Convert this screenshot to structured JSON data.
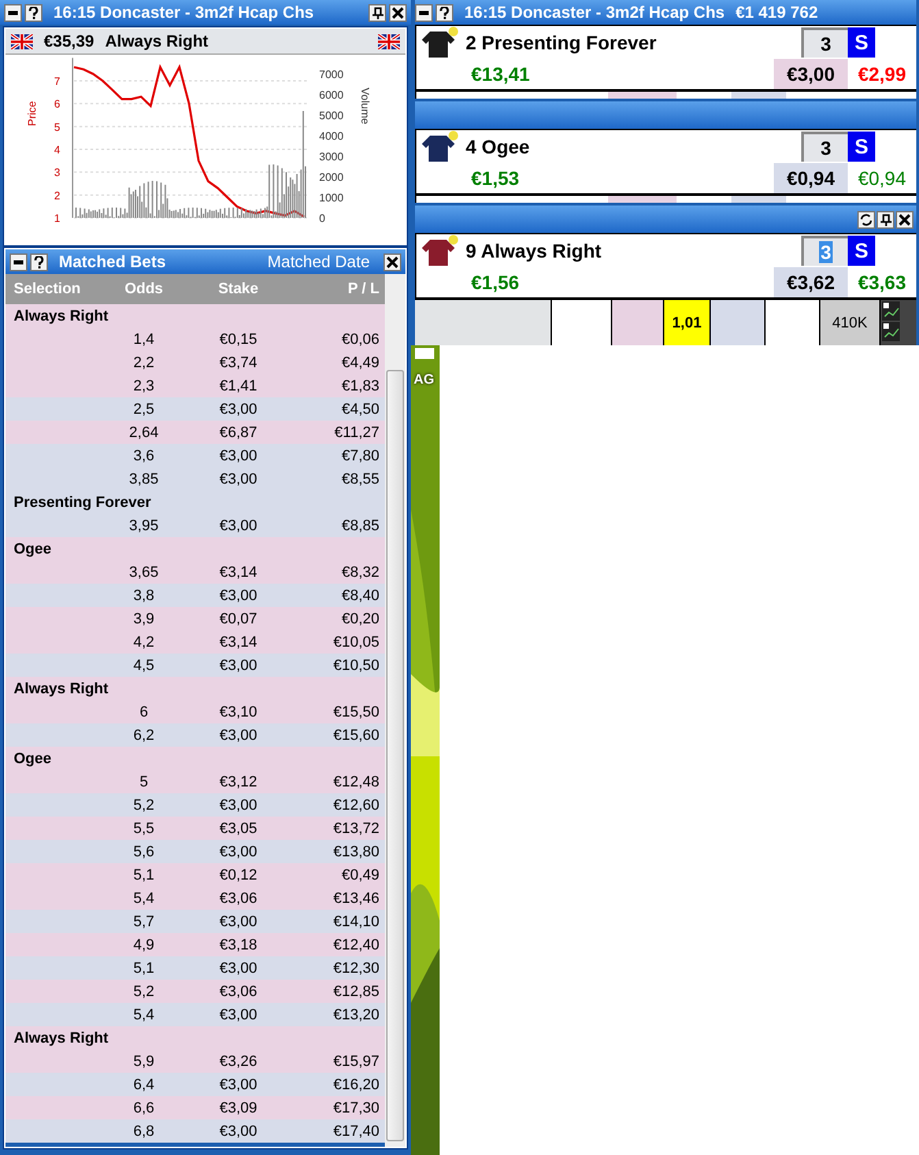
{
  "market_window": {
    "title": "16:15  Doncaster - 3m2f Hcap Chs",
    "runner": {
      "pl": "€35,39",
      "name": "Always Right"
    },
    "chart": {
      "chart_data": {
        "type": "line",
        "ylabel": "Price",
        "yticks": [
          1,
          2,
          3,
          4,
          5,
          6,
          7
        ],
        "ylim": [
          1,
          8
        ],
        "grid": true,
        "series": [
          {
            "color": "#e00000",
            "values": [
              7.6,
              7.5,
              7.3,
              7.0,
              6.6,
              6.2,
              6.2,
              6.3,
              5.9,
              7.6,
              6.8,
              7.6,
              6.0,
              3.5,
              2.6,
              2.3,
              1.9,
              1.5,
              1.3,
              1.2,
              1.3,
              1.2,
              1.1,
              1.3,
              1.05
            ]
          }
        ]
      },
      "volume_label": "Volume",
      "volume_ticks": [
        "7000",
        "6000",
        "5000",
        "4000",
        "3000",
        "2000",
        "1000",
        "0"
      ]
    }
  },
  "matched_bets": {
    "title": "Matched Bets",
    "sort_link": "Matched Date",
    "columns": [
      "Selection",
      "Odds",
      "Stake",
      "P / L"
    ],
    "groups": [
      {
        "selection": "Always Right",
        "kind": "back",
        "bets": [
          {
            "odds": "1,4",
            "stake": "€0,15",
            "pl": "€0,06",
            "kind": "back"
          },
          {
            "odds": "2,2",
            "stake": "€3,74",
            "pl": "€4,49",
            "kind": "back"
          },
          {
            "odds": "2,3",
            "stake": "€1,41",
            "pl": "€1,83",
            "kind": "back"
          },
          {
            "odds": "2,5",
            "stake": "€3,00",
            "pl": "€4,50",
            "kind": "lay"
          },
          {
            "odds": "2,64",
            "stake": "€6,87",
            "pl": "€11,27",
            "kind": "back"
          },
          {
            "odds": "3,6",
            "stake": "€3,00",
            "pl": "€7,80",
            "kind": "lay"
          },
          {
            "odds": "3,85",
            "stake": "€3,00",
            "pl": "€8,55",
            "kind": "lay"
          }
        ]
      },
      {
        "selection": "Presenting Forever",
        "kind": "lay",
        "bets": [
          {
            "odds": "3,95",
            "stake": "€3,00",
            "pl": "€8,85",
            "kind": "lay"
          }
        ]
      },
      {
        "selection": "Ogee",
        "kind": "back",
        "bets": [
          {
            "odds": "3,65",
            "stake": "€3,14",
            "pl": "€8,32",
            "kind": "back"
          },
          {
            "odds": "3,8",
            "stake": "€3,00",
            "pl": "€8,40",
            "kind": "lay"
          },
          {
            "odds": "3,9",
            "stake": "€0,07",
            "pl": "€0,20",
            "kind": "back"
          },
          {
            "odds": "4,2",
            "stake": "€3,14",
            "pl": "€10,05",
            "kind": "back"
          },
          {
            "odds": "4,5",
            "stake": "€3,00",
            "pl": "€10,50",
            "kind": "lay"
          }
        ]
      },
      {
        "selection": "Always Right",
        "kind": "back",
        "bets": [
          {
            "odds": "6",
            "stake": "€3,10",
            "pl": "€15,50",
            "kind": "back"
          },
          {
            "odds": "6,2",
            "stake": "€3,00",
            "pl": "€15,60",
            "kind": "lay"
          }
        ]
      },
      {
        "selection": "Ogee",
        "kind": "back",
        "bets": [
          {
            "odds": "5",
            "stake": "€3,12",
            "pl": "€12,48",
            "kind": "back"
          },
          {
            "odds": "5,2",
            "stake": "€3,00",
            "pl": "€12,60",
            "kind": "lay"
          },
          {
            "odds": "5,5",
            "stake": "€3,05",
            "pl": "€13,72",
            "kind": "back"
          },
          {
            "odds": "5,6",
            "stake": "€3,00",
            "pl": "€13,80",
            "kind": "lay"
          },
          {
            "odds": "5,1",
            "stake": "€0,12",
            "pl": "€0,49",
            "kind": "back"
          },
          {
            "odds": "5,4",
            "stake": "€3,06",
            "pl": "€13,46",
            "kind": "back"
          },
          {
            "odds": "5,7",
            "stake": "€3,00",
            "pl": "€14,10",
            "kind": "lay"
          },
          {
            "odds": "4,9",
            "stake": "€3,18",
            "pl": "€12,40",
            "kind": "back"
          },
          {
            "odds": "5,1",
            "stake": "€3,00",
            "pl": "€12,30",
            "kind": "lay"
          },
          {
            "odds": "5,2",
            "stake": "€3,06",
            "pl": "€12,85",
            "kind": "back"
          },
          {
            "odds": "5,4",
            "stake": "€3,00",
            "pl": "€13,20",
            "kind": "lay"
          }
        ]
      },
      {
        "selection": "Always Right",
        "kind": "back",
        "bets": [
          {
            "odds": "5,9",
            "stake": "€3,26",
            "pl": "€15,97",
            "kind": "back"
          },
          {
            "odds": "6,4",
            "stake": "€3,00",
            "pl": "€16,20",
            "kind": "lay"
          },
          {
            "odds": "6,6",
            "stake": "€3,09",
            "pl": "€17,30",
            "kind": "back"
          },
          {
            "odds": "6,8",
            "stake": "€3,00",
            "pl": "€17,40",
            "kind": "lay"
          }
        ]
      }
    ]
  },
  "ladder_window": {
    "title": "16:15  Doncaster - 3m2f Hcap Chs",
    "matched_total": "€1 419 762",
    "runners": [
      {
        "name": "2 Presenting Forever",
        "color": "#1c1c1c",
        "stake": "3",
        "stake_selected": false,
        "button": "S",
        "pl": "€13,41",
        "price": {
          "text": "€3,00",
          "kind": "back"
        },
        "hedge": {
          "text": "€2,99",
          "kind": "loss"
        },
        "title_bar": false
      },
      {
        "name": "4 Ogee",
        "color": "#1a2a5c",
        "stake": "3",
        "stake_selected": false,
        "button": "S",
        "pl": "€1,53",
        "price": {
          "text": "€0,94",
          "kind": "lay"
        },
        "hedge": {
          "text": "€0,94",
          "kind": "neutral"
        },
        "title_bar": true
      },
      {
        "name": "9 Always Right",
        "color": "#8a1c2c",
        "stake": "3",
        "stake_selected": true,
        "button": "S",
        "pl": "€1,56",
        "price": {
          "text": "€3,62",
          "kind": "lay"
        },
        "hedge": {
          "text": "€3,63",
          "kind": "profit"
        },
        "title_bar": true
      }
    ],
    "ladder_row": {
      "last_price": "1,01",
      "volume": "410K"
    }
  },
  "desktop": {
    "icon_label": "AG"
  }
}
